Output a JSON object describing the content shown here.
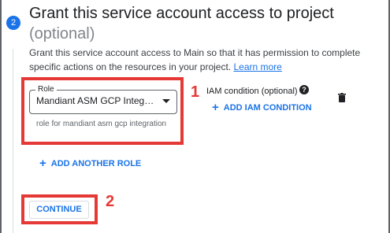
{
  "step": {
    "number": "2",
    "title": "Grant this service account access to project",
    "subtitle": "(optional)",
    "description": "Grant this service account access to Main so that it has permission to complete specific actions on the resources in your project.",
    "learn_more": "Learn more"
  },
  "role_select": {
    "label": "Role",
    "value": "Mandiant ASM GCP Integrati...",
    "hint": "role for mandiant asm gcp integration"
  },
  "iam_condition": {
    "label": "IAM condition (optional)",
    "add_label": "ADD IAM CONDITION"
  },
  "add_role_label": "ADD ANOTHER ROLE",
  "continue_label": "CONTINUE",
  "annotations": {
    "marker_1": "1",
    "marker_2": "2"
  },
  "icons": {
    "help": "help-icon",
    "delete": "trash-icon",
    "add": "plus-icon",
    "dropdown": "caret-down-icon"
  },
  "colors": {
    "accent": "#1a73e8",
    "highlight": "#e53935"
  }
}
